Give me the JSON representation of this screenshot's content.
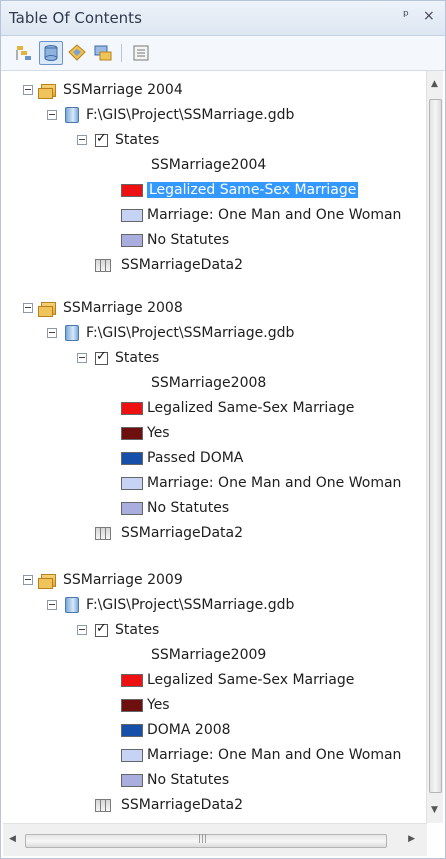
{
  "window": {
    "title": "Table Of Contents",
    "pin_glyph": "ᵖ",
    "close_glyph": "×"
  },
  "toolbar": {
    "icons": [
      "list-by-drawing-order-icon",
      "list-by-source-icon",
      "list-by-visibility-icon",
      "list-by-selection-icon",
      "options-icon"
    ]
  },
  "groups": [
    {
      "name": "SSMarriage 2004",
      "source": "F:\\GIS\\Project\\SSMarriage.gdb",
      "layer": "States",
      "field": "SSMarriage2004",
      "legend": [
        {
          "label": "Legalized Same-Sex Marriage",
          "color": "#ee1111",
          "selected": true
        },
        {
          "label": "Marriage: One Man and One Woman",
          "color": "#c6d3f4"
        },
        {
          "label": "No Statutes",
          "color": "#a9aede"
        }
      ],
      "table": "SSMarriageData2"
    },
    {
      "name": "SSMarriage 2008",
      "source": "F:\\GIS\\Project\\SSMarriage.gdb",
      "layer": "States",
      "field": "SSMarriage2008",
      "legend": [
        {
          "label": "Legalized Same-Sex Marriage",
          "color": "#ee1111"
        },
        {
          "label": "Yes",
          "color": "#6d0f0f"
        },
        {
          "label": "Passed DOMA",
          "color": "#1750a8"
        },
        {
          "label": "Marriage: One Man and One Woman",
          "color": "#c6d3f4"
        },
        {
          "label": "No Statutes",
          "color": "#a9aede"
        }
      ],
      "table": "SSMarriageData2"
    },
    {
      "name": "SSMarriage 2009",
      "source": "F:\\GIS\\Project\\SSMarriage.gdb",
      "layer": "States",
      "field": "SSMarriage2009",
      "legend": [
        {
          "label": "Legalized Same-Sex Marriage",
          "color": "#ee1111"
        },
        {
          "label": "Yes",
          "color": "#6d0f0f"
        },
        {
          "label": "DOMA 2008",
          "color": "#1750a8"
        },
        {
          "label": "Marriage: One Man and One Woman",
          "color": "#c6d3f4"
        },
        {
          "label": "No Statutes",
          "color": "#a9aede"
        }
      ],
      "table": "SSMarriageData2"
    }
  ],
  "scroll": {
    "up": "▲",
    "down": "▼",
    "left": "◀",
    "right": "▶",
    "grip": "|||"
  }
}
